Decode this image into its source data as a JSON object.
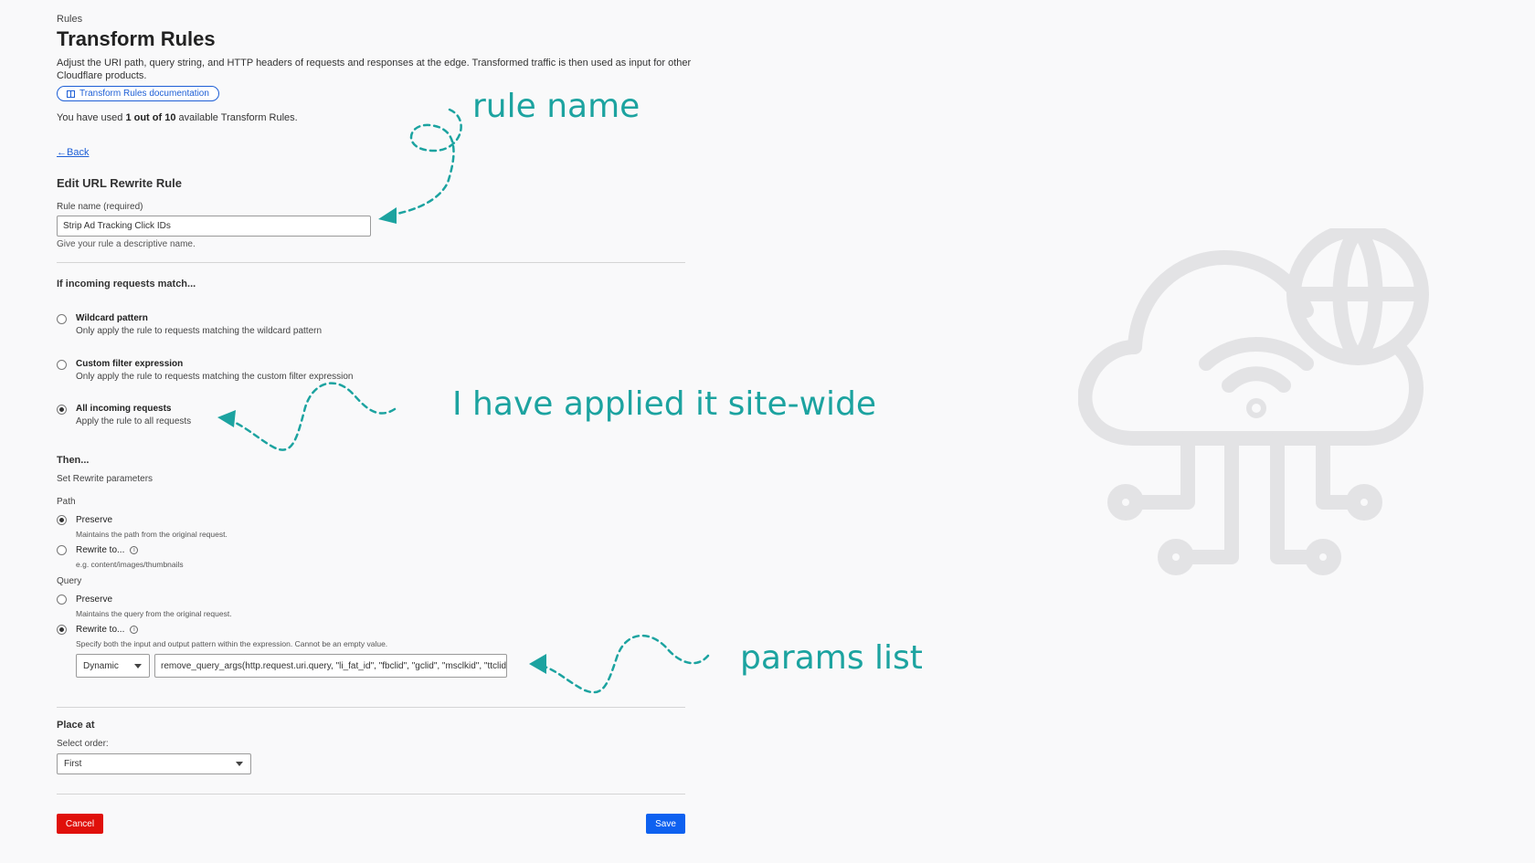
{
  "header": {
    "breadcrumb": "Rules",
    "title": "Transform Rules",
    "description": "Adjust the URI path, query string, and HTTP headers of requests and responses at the edge. Transformed traffic is then used as input for other Cloudflare products.",
    "docs_button": "Transform Rules documentation",
    "usage_prefix": "You have used ",
    "usage_count": "1 out of 10",
    "usage_suffix": " available Transform Rules."
  },
  "back_link": "Back",
  "form": {
    "heading": "Edit URL Rewrite Rule",
    "rule_name_label": "Rule name (required)",
    "rule_name_value": "Strip Ad Tracking Click IDs",
    "rule_name_hint": "Give your rule a descriptive name.",
    "match_heading": "If incoming requests match...",
    "match_options": [
      {
        "title": "Wildcard pattern",
        "subtitle": "Only apply the rule to requests matching the wildcard pattern",
        "selected": false
      },
      {
        "title": "Custom filter expression",
        "subtitle": "Only apply the rule to requests matching the custom filter expression",
        "selected": false
      },
      {
        "title": "All incoming requests",
        "subtitle": "Apply the rule to all requests",
        "selected": true
      }
    ],
    "then_heading": "Then...",
    "then_sub": "Set Rewrite parameters",
    "path": {
      "label": "Path",
      "preserve_title": "Preserve",
      "preserve_sub": "Maintains the path from the original request.",
      "rewrite_title": "Rewrite to...",
      "rewrite_sub": "e.g. content/images/thumbnails",
      "selected": "preserve"
    },
    "query": {
      "label": "Query",
      "preserve_title": "Preserve",
      "preserve_sub": "Maintains the query from the original request.",
      "rewrite_title": "Rewrite to...",
      "rewrite_sub": "Specify both the input and output pattern within the expression. Cannot be an empty value.",
      "selected": "rewrite",
      "mode_value": "Dynamic",
      "expression_value": "remove_query_args(http.request.uri.query, \"li_fat_id\", \"fbclid\", \"gclid\", \"msclkid\", \"ttclid\""
    },
    "place_heading": "Place at",
    "order_label": "Select order:",
    "order_value": "First",
    "cancel_label": "Cancel",
    "save_label": "Save"
  },
  "annotations": {
    "rule_name": "rule name",
    "site_wide": "I have applied it site-wide",
    "params": "params list"
  },
  "colors": {
    "annotation": "#1ca3a0",
    "link": "#1e5fd6",
    "cancel": "#e0100a",
    "save": "#0e61f0"
  }
}
